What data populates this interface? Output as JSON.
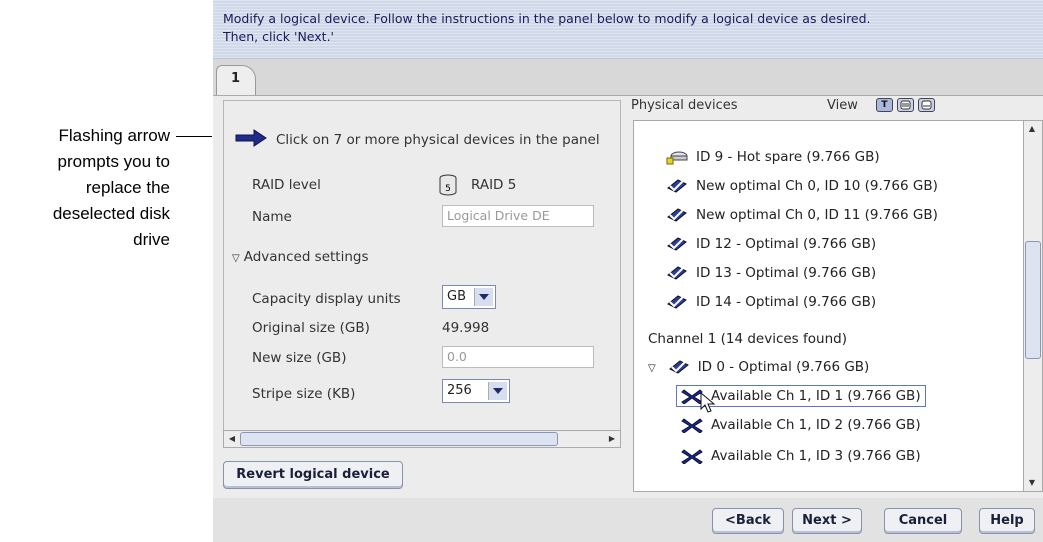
{
  "callout": {
    "lines": [
      "Flashing arrow",
      "prompts you to",
      "replace the",
      "deselected disk",
      "drive"
    ]
  },
  "instructions": {
    "line1": "Modify a logical device.  Follow the instructions in the panel below to modify a logical device as desired.",
    "line2": "Then, click 'Next.'"
  },
  "tab": {
    "label": "1"
  },
  "left_panel": {
    "hint": "Click on 7 or more physical devices in the panel",
    "raid_level_label": "RAID level",
    "raid_badge": "5",
    "raid_value": "RAID 5",
    "name_label": "Name",
    "name_value": "Logical Drive DE",
    "advanced_label": "Advanced settings",
    "capacity_units_label": "Capacity display units",
    "capacity_units_value": "GB",
    "original_size_label": "Original size (GB)",
    "original_size_value": "49.998",
    "new_size_label": "New size (GB)",
    "new_size_placeholder": "0.0",
    "stripe_size_label": "Stripe size (KB)",
    "stripe_size_value": "256",
    "revert_button": "Revert logical device"
  },
  "right_panel": {
    "title": "Physical devices",
    "view_label": "View",
    "view_buttons": [
      "T",
      "",
      ""
    ],
    "devices": [
      {
        "text": "ID 9 - Hot spare (9.766 GB)",
        "icon": "hot-spare-icon"
      },
      {
        "text": "New optimal  Ch 0, ID 10 (9.766 GB)",
        "icon": "optimal-disk-icon"
      },
      {
        "text": "New optimal  Ch 0, ID 11 (9.766 GB)",
        "icon": "optimal-disk-icon"
      },
      {
        "text": "ID 12 - Optimal (9.766 GB)",
        "icon": "optimal-disk-icon"
      },
      {
        "text": "ID 13 - Optimal (9.766 GB)",
        "icon": "optimal-disk-icon"
      },
      {
        "text": "ID 14 - Optimal (9.766 GB)",
        "icon": "optimal-disk-icon"
      }
    ],
    "channel_label": "Channel 1   (14 devices found)",
    "channel_devices": [
      {
        "text": "ID 0 - Optimal (9.766 GB)",
        "icon": "optimal-disk-icon"
      },
      {
        "text": "Available  Ch 1, ID 1 (9.766 GB)",
        "icon": "available-disk-icon"
      },
      {
        "text": "Available  Ch 1, ID 2 (9.766 GB)",
        "icon": "available-disk-icon"
      },
      {
        "text": "Available  Ch 1, ID 3 (9.766 GB)",
        "icon": "available-disk-icon"
      }
    ]
  },
  "footer": {
    "back": "<Back",
    "next": "Next >",
    "cancel": "Cancel",
    "help": "Help"
  },
  "colors": {
    "instruction_bg": "#cfd9ea",
    "accent_navy": "#1f2a66",
    "selection": "#5a78c8"
  }
}
